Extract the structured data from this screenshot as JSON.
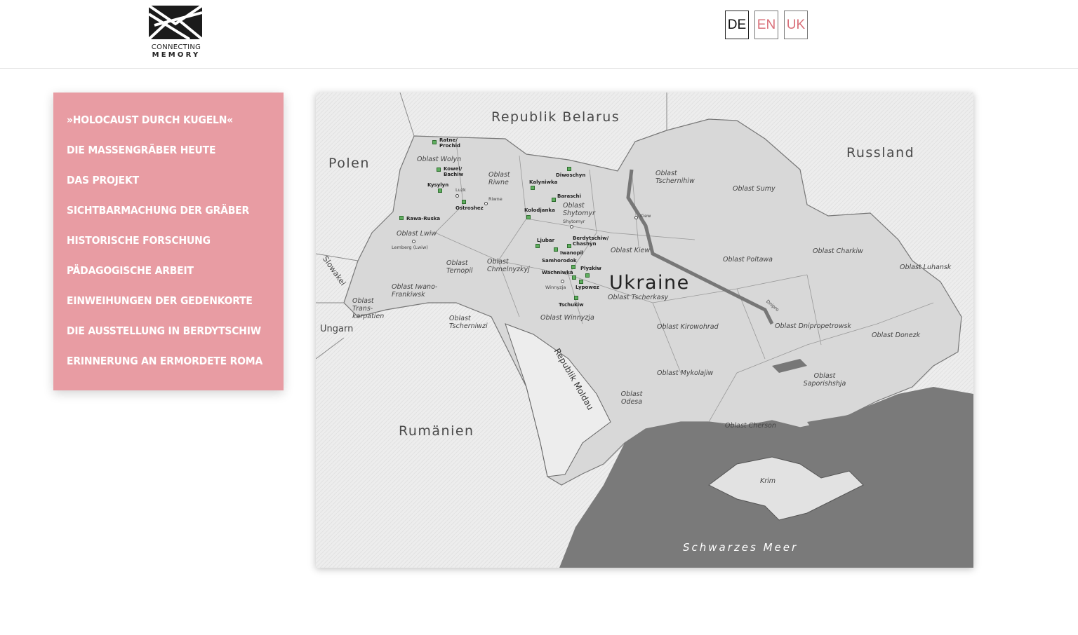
{
  "header": {
    "logo_line1": "CONNECTING",
    "logo_line2": "MEMORY",
    "languages": [
      {
        "code": "DE",
        "active": true
      },
      {
        "code": "EN",
        "active": false
      },
      {
        "code": "UK",
        "active": false
      }
    ]
  },
  "menu": {
    "items": [
      "»Holocaust durch Kugeln«",
      "Die Massengräber heute",
      "Das Projekt",
      "Sichtbarmachung der Gräber",
      "Historische Forschung",
      "Pädagogische Arbeit",
      "Einweihungen der Gedenkorte",
      "Die Ausstellung in Berdytschiw",
      "Erinnerung an ermordete Roma"
    ]
  },
  "map": {
    "countries": {
      "belarus": "Republik Belarus",
      "poland": "Polen",
      "russia": "Russland",
      "slovakia": "Slowakei",
      "hungary": "Ungarn",
      "moldova": "Republik Moldau",
      "romania": "Rumänien",
      "ukraine": "Ukraine"
    },
    "sea": "Schwarzes Meer",
    "oblasts": {
      "wolyn": "Oblast Wolyn",
      "riwne": "Oblast Riwne",
      "shytomyr": "Oblast Shytomyr",
      "tschernihiw": "Oblast Tschernihiw",
      "sumy": "Oblast Sumy",
      "lwiw": "Oblast Lwiw",
      "kiew": "Oblast Kiew",
      "poltawa": "Oblast Poltawa",
      "charkiw": "Oblast Charkiw",
      "luhansk": "Oblast Luhansk",
      "ternopil": "Oblast Ternopil",
      "chmelnyzkyj": "Oblast Chmelnyzkyj",
      "iwano": "Oblast Iwano-Frankiwsk",
      "tscherkasy": "Oblast Tscherkasy",
      "transkarpatien": "Oblast Trans-karpatien",
      "tscherniwzi": "Oblast Tscherniwzi",
      "winnyzja": "Oblast Winnyzja",
      "kirowohrad": "Oblast Kirowohrad",
      "dnipro": "Oblast Dnipropetrowsk",
      "donezk": "Oblast Donezk",
      "mykolajiw": "Oblast Mykolajiw",
      "saporishshja": "Oblast Saporishshja",
      "odesa": "Oblast Odesa",
      "cherson": "Oblast Cherson",
      "krim": "Krim"
    },
    "sites": {
      "ratne": "Ratne/ Prochid",
      "kowel": "Kowel/ Bachiw",
      "kysylyn": "Kysylyn",
      "ostroshez": "Ostroshez",
      "rawa": "Rawa-Ruska",
      "diwoschyn": "Diwoschyn",
      "kalyniwka": "Kalyniwka",
      "baraschi": "Baraschi",
      "kolodjanka": "Kolodjanka",
      "ljubar": "Ljubar",
      "berdytschiw": "Berdytschiw/ Chashyn",
      "iwanopil": "Iwanopil",
      "samhorodok": "Samhorodok",
      "plyskiw": "Plyskiw",
      "wachniwka": "Wachniwka",
      "lypowez": "Lypowez",
      "tschukiw": "Tschukiw"
    },
    "towns": {
      "luzk": "Luzk",
      "riwne": "Riwne",
      "shytomyr": "Shytomyr",
      "lemberg": "Lemberg (Lwiw)",
      "winnyzja": "Winnyzja",
      "kiew": "Kiew",
      "dnipro": "Dnipro"
    }
  }
}
